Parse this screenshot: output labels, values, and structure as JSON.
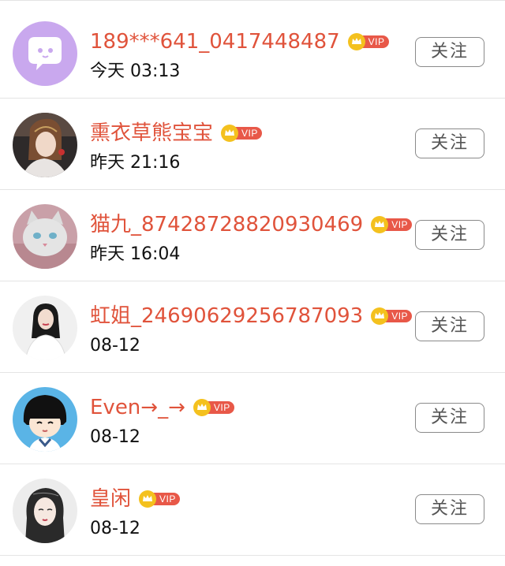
{
  "colors": {
    "name": "#e0533b",
    "vip_badge": "#e85848",
    "crown": "#f4c11e",
    "divider": "#e4e4e4"
  },
  "users": [
    {
      "name": "189***641_0417448487",
      "vip": "VIP",
      "time": "今天 03:13",
      "follow": "关注"
    },
    {
      "name": "熏衣草熊宝宝",
      "vip": "VIP",
      "time": "昨天 21:16",
      "follow": "关注"
    },
    {
      "name": "猫九_87428728820930469",
      "vip": "VIP",
      "time": "昨天 16:04",
      "follow": "关注"
    },
    {
      "name": "虹姐_24690629256787093",
      "vip": "VIP",
      "time": "08-12",
      "follow": "关注"
    },
    {
      "name": "Even→_→",
      "vip": "VIP",
      "time": "08-12",
      "follow": "关注"
    },
    {
      "name": "皇闲",
      "vip": "VIP",
      "time": "08-12",
      "follow": "关注"
    }
  ]
}
